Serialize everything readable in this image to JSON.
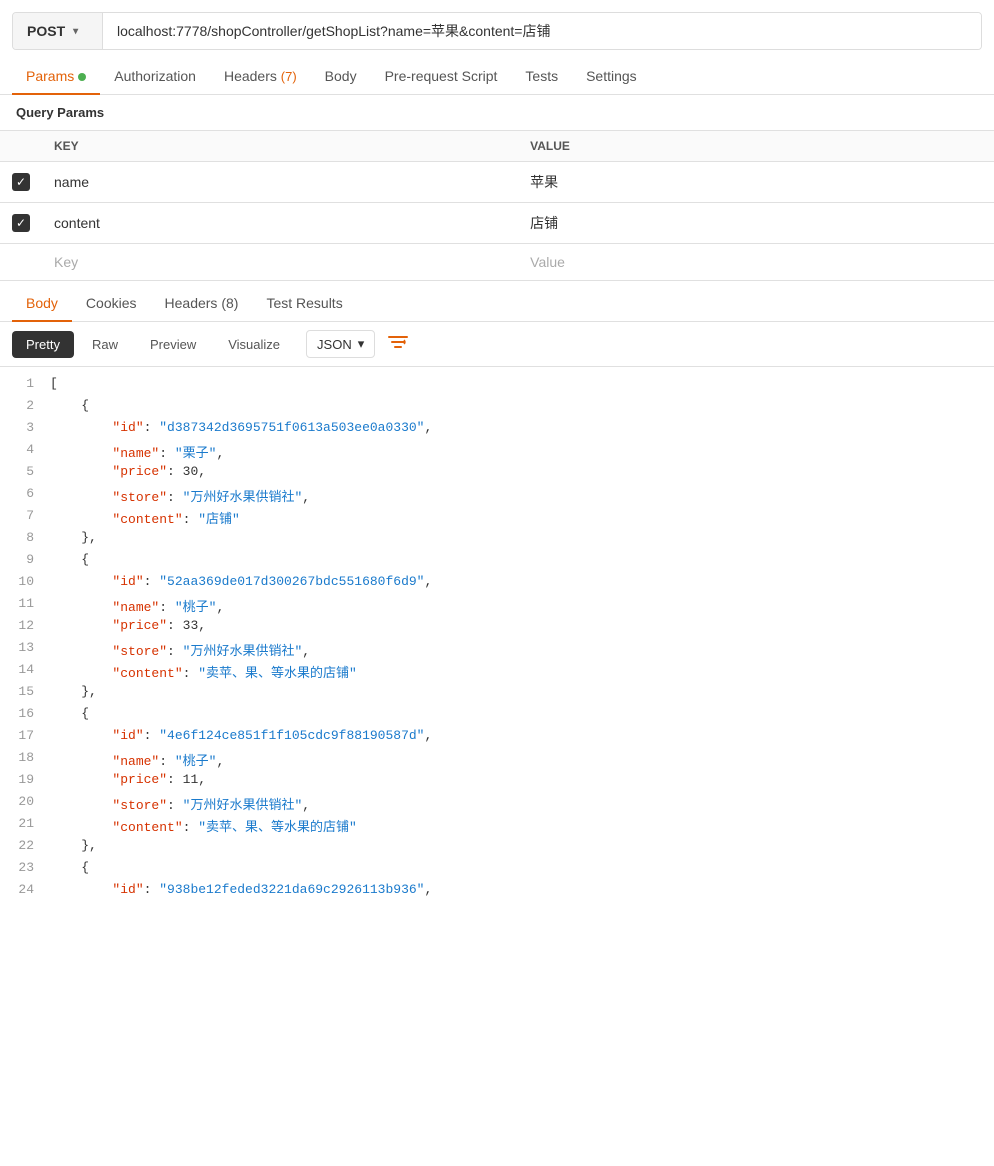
{
  "urlBar": {
    "method": "POST",
    "url": "localhost:7778/shopController/getShopList?name=苹果&content=店铺",
    "chevron": "▾"
  },
  "requestTabs": [
    {
      "id": "params",
      "label": "Params",
      "dot": true,
      "badge": null,
      "active": true
    },
    {
      "id": "authorization",
      "label": "Authorization",
      "dot": false,
      "badge": null,
      "active": false
    },
    {
      "id": "headers",
      "label": "Headers",
      "dot": false,
      "badge": "7",
      "active": false
    },
    {
      "id": "body",
      "label": "Body",
      "dot": false,
      "badge": null,
      "active": false
    },
    {
      "id": "prerequest",
      "label": "Pre-request Script",
      "dot": false,
      "badge": null,
      "active": false
    },
    {
      "id": "tests",
      "label": "Tests",
      "dot": false,
      "badge": null,
      "active": false
    },
    {
      "id": "settings",
      "label": "Settings",
      "dot": false,
      "badge": null,
      "active": false
    }
  ],
  "queryParams": {
    "sectionLabel": "Query Params",
    "columns": [
      "",
      "KEY",
      "VALUE"
    ],
    "rows": [
      {
        "checked": true,
        "key": "name",
        "value": "苹果"
      },
      {
        "checked": true,
        "key": "content",
        "value": "店铺"
      }
    ],
    "placeholderKey": "Key",
    "placeholderValue": "Value"
  },
  "responseTabs": [
    {
      "id": "body",
      "label": "Body",
      "active": true
    },
    {
      "id": "cookies",
      "label": "Cookies",
      "active": false
    },
    {
      "id": "headers",
      "label": "Headers",
      "badge": "8",
      "active": false
    },
    {
      "id": "testresults",
      "label": "Test Results",
      "active": false
    }
  ],
  "formatButtons": [
    {
      "id": "pretty",
      "label": "Pretty",
      "active": true
    },
    {
      "id": "raw",
      "label": "Raw",
      "active": false
    },
    {
      "id": "preview",
      "label": "Preview",
      "active": false
    },
    {
      "id": "visualize",
      "label": "Visualize",
      "active": false
    }
  ],
  "jsonFormat": "JSON",
  "codeLines": [
    {
      "num": 1,
      "content": "[",
      "type": "bracket"
    },
    {
      "num": 2,
      "content": "    {",
      "type": "bracket"
    },
    {
      "num": 3,
      "content": "        \"id\": \"d387342d3695751f0613a503ee0a0330\",",
      "parts": [
        {
          "t": "key",
          "v": "\"id\""
        },
        {
          "t": "colon",
          "v": ": "
        },
        {
          "t": "string",
          "v": "\"d387342d3695751f0613a503ee0a0330\""
        },
        {
          "t": "comma",
          "v": ","
        }
      ]
    },
    {
      "num": 4,
      "content": "        \"name\": \"栗子\",",
      "parts": [
        {
          "t": "key",
          "v": "\"name\""
        },
        {
          "t": "colon",
          "v": ": "
        },
        {
          "t": "string",
          "v": "\"栗子\""
        },
        {
          "t": "comma",
          "v": ","
        }
      ]
    },
    {
      "num": 5,
      "content": "        \"price\": 30,",
      "parts": [
        {
          "t": "key",
          "v": "\"price\""
        },
        {
          "t": "colon",
          "v": ": "
        },
        {
          "t": "number",
          "v": "30"
        },
        {
          "t": "comma",
          "v": ","
        }
      ]
    },
    {
      "num": 6,
      "content": "        \"store\": \"万州好水果供销社\",",
      "parts": [
        {
          "t": "key",
          "v": "\"store\""
        },
        {
          "t": "colon",
          "v": ": "
        },
        {
          "t": "string",
          "v": "\"万州好水果供销社\""
        },
        {
          "t": "comma",
          "v": ","
        }
      ]
    },
    {
      "num": 7,
      "content": "        \"content\": \"店铺\"",
      "parts": [
        {
          "t": "key",
          "v": "\"content\""
        },
        {
          "t": "colon",
          "v": ": "
        },
        {
          "t": "string",
          "v": "\"店铺\""
        }
      ]
    },
    {
      "num": 8,
      "content": "    },",
      "type": "bracket"
    },
    {
      "num": 9,
      "content": "    {",
      "type": "bracket"
    },
    {
      "num": 10,
      "content": "        \"id\": \"52aa369de017d300267bdc551680f6d9\",",
      "parts": [
        {
          "t": "key",
          "v": "\"id\""
        },
        {
          "t": "colon",
          "v": ": "
        },
        {
          "t": "string",
          "v": "\"52aa369de017d300267bdc551680f6d9\""
        },
        {
          "t": "comma",
          "v": ","
        }
      ]
    },
    {
      "num": 11,
      "content": "        \"name\": \"桃子\",",
      "parts": [
        {
          "t": "key",
          "v": "\"name\""
        },
        {
          "t": "colon",
          "v": ": "
        },
        {
          "t": "string",
          "v": "\"桃子\""
        },
        {
          "t": "comma",
          "v": ","
        }
      ]
    },
    {
      "num": 12,
      "content": "        \"price\": 33,",
      "parts": [
        {
          "t": "key",
          "v": "\"price\""
        },
        {
          "t": "colon",
          "v": ": "
        },
        {
          "t": "number",
          "v": "33"
        },
        {
          "t": "comma",
          "v": ","
        }
      ]
    },
    {
      "num": 13,
      "content": "        \"store\": \"万州好水果供销社\",",
      "parts": [
        {
          "t": "key",
          "v": "\"store\""
        },
        {
          "t": "colon",
          "v": ": "
        },
        {
          "t": "string",
          "v": "\"万州好水果供销社\""
        },
        {
          "t": "comma",
          "v": ","
        }
      ]
    },
    {
      "num": 14,
      "content": "        \"content\": \"卖苹、果、等水果的店铺\"",
      "parts": [
        {
          "t": "key",
          "v": "\"content\""
        },
        {
          "t": "colon",
          "v": ": "
        },
        {
          "t": "string",
          "v": "\"卖苹、果、等水果的店铺\""
        }
      ]
    },
    {
      "num": 15,
      "content": "    },",
      "type": "bracket"
    },
    {
      "num": 16,
      "content": "    {",
      "type": "bracket"
    },
    {
      "num": 17,
      "content": "        \"id\": \"4e6f124ce851f1f105cdc9f88190587d\",",
      "parts": [
        {
          "t": "key",
          "v": "\"id\""
        },
        {
          "t": "colon",
          "v": ": "
        },
        {
          "t": "string",
          "v": "\"4e6f124ce851f1f105cdc9f88190587d\""
        },
        {
          "t": "comma",
          "v": ","
        }
      ]
    },
    {
      "num": 18,
      "content": "        \"name\": \"桃子\",",
      "parts": [
        {
          "t": "key",
          "v": "\"name\""
        },
        {
          "t": "colon",
          "v": ": "
        },
        {
          "t": "string",
          "v": "\"桃子\""
        },
        {
          "t": "comma",
          "v": ","
        }
      ]
    },
    {
      "num": 19,
      "content": "        \"price\": 11,",
      "parts": [
        {
          "t": "key",
          "v": "\"price\""
        },
        {
          "t": "colon",
          "v": ": "
        },
        {
          "t": "number",
          "v": "11"
        },
        {
          "t": "comma",
          "v": ","
        }
      ]
    },
    {
      "num": 20,
      "content": "        \"store\": \"万州好水果供销社\",",
      "parts": [
        {
          "t": "key",
          "v": "\"store\""
        },
        {
          "t": "colon",
          "v": ": "
        },
        {
          "t": "string",
          "v": "\"万州好水果供销社\""
        },
        {
          "t": "comma",
          "v": ","
        }
      ]
    },
    {
      "num": 21,
      "content": "        \"content\": \"卖苹、果、等水果的店铺\"",
      "parts": [
        {
          "t": "key",
          "v": "\"content\""
        },
        {
          "t": "colon",
          "v": ": "
        },
        {
          "t": "string",
          "v": "\"卖苹、果、等水果的店铺\""
        }
      ]
    },
    {
      "num": 22,
      "content": "    },",
      "type": "bracket"
    },
    {
      "num": 23,
      "content": "    {",
      "type": "bracket"
    },
    {
      "num": 24,
      "content": "        \"id\": \"938be12feded3221da69c2926113b936\",",
      "parts": [
        {
          "t": "key",
          "v": "\"id\""
        },
        {
          "t": "colon",
          "v": ": "
        },
        {
          "t": "string",
          "v": "\"938be12feded3221da69c2926113b936\""
        },
        {
          "t": "comma",
          "v": ","
        }
      ]
    }
  ],
  "colors": {
    "accent": "#e36209",
    "activeTab": "#e36209",
    "jsonKey": "#d63200",
    "jsonString": "#1a7acc",
    "jsonNumber": "#333",
    "dot": "#4caf50"
  }
}
